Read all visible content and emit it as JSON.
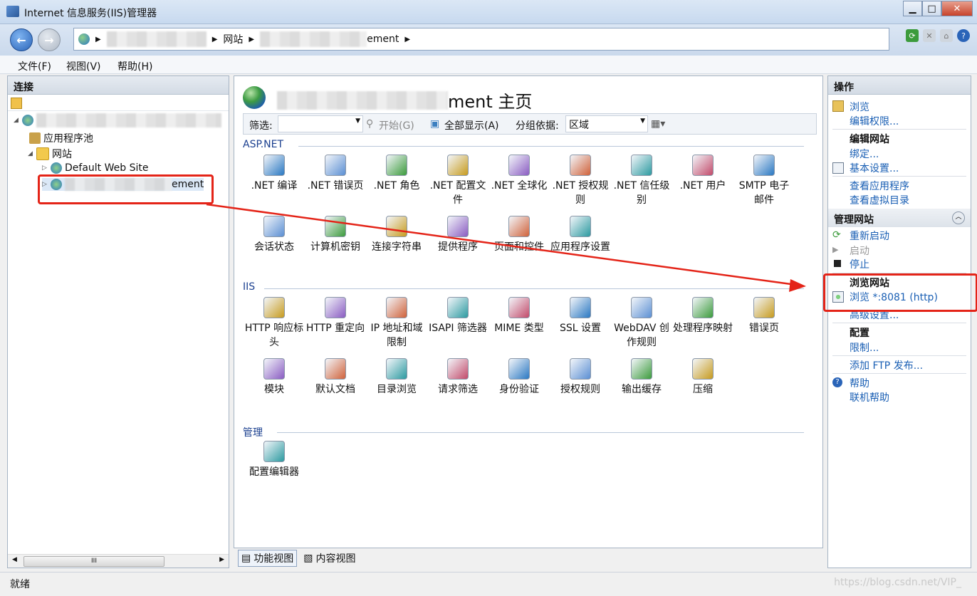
{
  "window": {
    "title": "Internet 信息服务(IIS)管理器"
  },
  "address": {
    "crumb_site": "网站",
    "crumb_tail": "ement"
  },
  "menu": {
    "file": "文件(F)",
    "view": "视图(V)",
    "help": "帮助(H)"
  },
  "left": {
    "header": "连接",
    "tree": {
      "app_pools": "应用程序池",
      "sites": "网站",
      "default_site": "Default Web Site",
      "custom_site_tail": "ement"
    },
    "scroll_thumb": "III"
  },
  "main": {
    "title_tail": "ment 主页",
    "filter": {
      "label": "筛选:",
      "start": "开始(G)",
      "show_all": "全部显示(A)",
      "group_by": "分组依据:",
      "group_value": "区域"
    },
    "groups": [
      {
        "name": "ASP.NET",
        "items": [
          {
            "label": ".NET 编译",
            "icon": "compile-icon"
          },
          {
            "label": ".NET 错误页",
            "icon": "error-page-icon"
          },
          {
            "label": ".NET 角色",
            "icon": "roles-icon"
          },
          {
            "label": ".NET 配置文件",
            "icon": "profile-icon"
          },
          {
            "label": ".NET 全球化",
            "icon": "globe-icon"
          },
          {
            "label": ".NET 授权规则",
            "icon": "auth-rules-icon"
          },
          {
            "label": ".NET 信任级别",
            "icon": "trust-icon"
          },
          {
            "label": ".NET 用户",
            "icon": "users-icon"
          },
          {
            "label": "SMTP 电子邮件",
            "icon": "smtp-icon"
          },
          {
            "label": "会话状态",
            "icon": "session-icon"
          },
          {
            "label": "计算机密钥",
            "icon": "machine-key-icon"
          },
          {
            "label": "连接字符串",
            "icon": "conn-string-icon"
          },
          {
            "label": "提供程序",
            "icon": "providers-icon"
          },
          {
            "label": "页面和控件",
            "icon": "pages-controls-icon"
          },
          {
            "label": "应用程序设置",
            "icon": "app-settings-icon"
          }
        ]
      },
      {
        "name": "IIS",
        "items": [
          {
            "label": "HTTP 响应标头",
            "icon": "http-headers-icon"
          },
          {
            "label": "HTTP 重定向",
            "icon": "redirect-icon"
          },
          {
            "label": "IP 地址和域限制",
            "icon": "ip-restrict-icon"
          },
          {
            "label": "ISAPI 筛选器",
            "icon": "isapi-icon"
          },
          {
            "label": "MIME 类型",
            "icon": "mime-icon"
          },
          {
            "label": "SSL 设置",
            "icon": "lock-icon"
          },
          {
            "label": "WebDAV 创作规则",
            "icon": "webdav-icon"
          },
          {
            "label": "处理程序映射",
            "icon": "handler-icon"
          },
          {
            "label": "错误页",
            "icon": "error-page-icon"
          },
          {
            "label": "模块",
            "icon": "modules-icon"
          },
          {
            "label": "默认文档",
            "icon": "default-doc-icon"
          },
          {
            "label": "目录浏览",
            "icon": "dir-browse-icon"
          },
          {
            "label": "请求筛选",
            "icon": "request-filter-icon"
          },
          {
            "label": "身份验证",
            "icon": "authn-icon"
          },
          {
            "label": "授权规则",
            "icon": "authz-icon"
          },
          {
            "label": "输出缓存",
            "icon": "output-cache-icon"
          },
          {
            "label": "压缩",
            "icon": "compress-icon"
          }
        ]
      },
      {
        "name": "管理",
        "items": [
          {
            "label": "配置编辑器",
            "icon": "config-editor-icon"
          }
        ]
      }
    ],
    "tabs": {
      "features": "功能视图",
      "content": "内容视图"
    }
  },
  "actions": {
    "header": "操作",
    "browse": "浏览",
    "edit_perms": "编辑权限...",
    "edit_site": "编辑网站",
    "bindings": "绑定...",
    "basic_settings": "基本设置...",
    "view_apps": "查看应用程序",
    "view_vdirs": "查看虚拟目录",
    "manage_site": "管理网站",
    "restart": "重新启动",
    "start": "启动",
    "stop": "停止",
    "browse_site": "浏览网站",
    "browse_port": "浏览 *:8081 (http)",
    "advanced": "高级设置...",
    "config": "配置",
    "limits": "限制...",
    "add_ftp": "添加 FTP 发布...",
    "help": "帮助",
    "online_help": "联机帮助"
  },
  "status": {
    "text": "就绪",
    "watermark": "https://blog.csdn.net/VIP_"
  },
  "colors": {
    "accent": "#1a5fb4",
    "annotation_red": "#e42418"
  }
}
